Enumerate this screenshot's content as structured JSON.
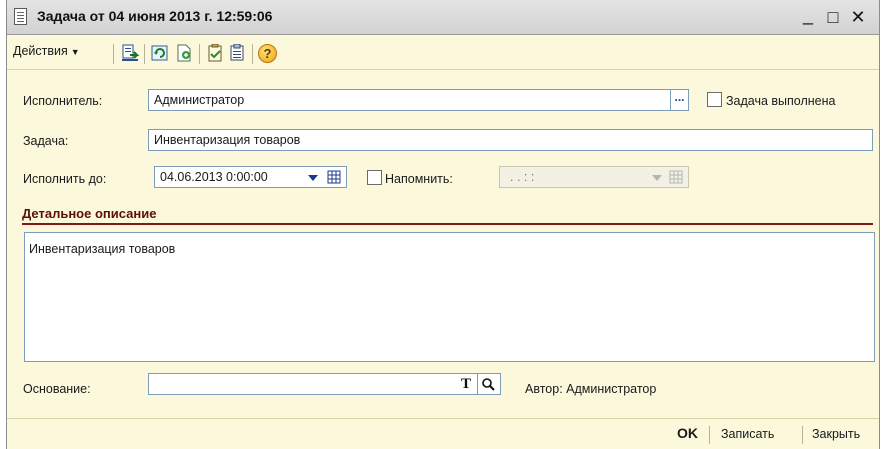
{
  "window": {
    "title": "Задача от 04 июня 2013 г. 12:59:06",
    "minimize_glyph": "_",
    "maximize_glyph": "□",
    "close_glyph": "✕"
  },
  "toolbar": {
    "actions_label": "Действия",
    "icons": [
      "post-and-close-icon",
      "refresh-icon",
      "new-document-icon",
      "task-list-icon",
      "print-icon",
      "help-icon"
    ],
    "help_glyph": "?"
  },
  "form": {
    "executor_label": "Исполнитель:",
    "executor_value": "Администратор",
    "select_button": "...",
    "task_done_label": "Задача выполнена",
    "task_label": "Задача:",
    "task_value": "Инвентаризация товаров",
    "due_label": "Исполнить до:",
    "due_value": "04.06.2013  0:00:00",
    "remind_label": "Напомнить:",
    "remind_value": " .  .       :  :"
  },
  "description": {
    "title": "Детальное описание",
    "text": "Инвентаризация товаров"
  },
  "basis": {
    "label": "Основание:",
    "value": "",
    "type_button": "T",
    "author_text": "Автор: Администратор"
  },
  "footer": {
    "ok_label": "OK",
    "save_label": "Записать",
    "close_label": "Закрыть"
  },
  "colors": {
    "window_bg": "#fbf8dc",
    "section_title": "#5a1010",
    "field_border": "#7f9db9"
  }
}
